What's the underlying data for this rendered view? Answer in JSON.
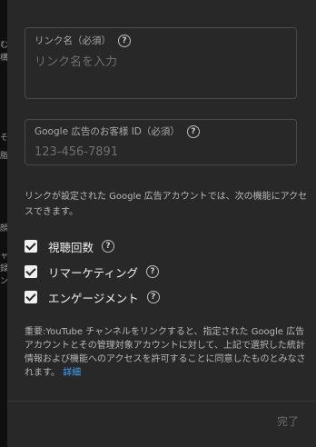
{
  "dialog": {
    "link_name_field": {
      "label": "リンク名（必須）",
      "placeholder": "リンク名を入力",
      "value": ""
    },
    "customer_id_field": {
      "label": "Google 広告のお客様 ID（必須）",
      "placeholder": "123-456-7891",
      "value": ""
    },
    "info_text": "リンクが設定された Google 広告アカウントでは、次の機能にアクセスできます。",
    "features": [
      {
        "label": "視聴回数",
        "checked": true
      },
      {
        "label": "リマーケティング",
        "checked": true
      },
      {
        "label": "エンゲージメント",
        "checked": true
      }
    ],
    "notice_text": "重要:YouTube チャンネルをリンクすると、指定された Google 広告アカウントとその管理対象アカウントに対して、上記で選択した統計情報および機能へのアクセスを許可することに同意したものとみなされます。",
    "notice_link": "詳細",
    "done_label": "完了",
    "help_glyph": "?"
  },
  "background_fragments": [
    "む",
    "構",
    "そ",
    "脂",
    "顔",
    "ャ",
    "録",
    "ン"
  ]
}
